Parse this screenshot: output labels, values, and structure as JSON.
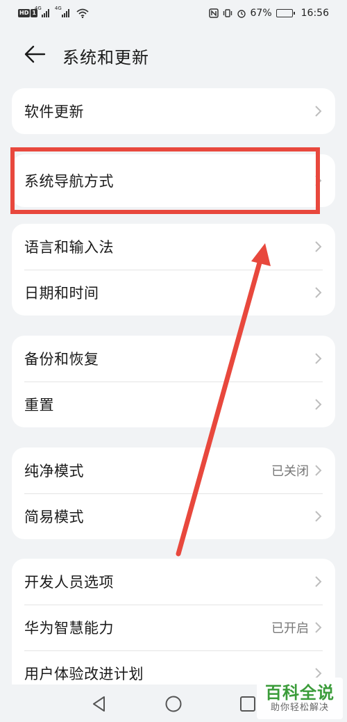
{
  "status_bar": {
    "hd": "HD",
    "sim1": "1",
    "net1": "4G",
    "net2": "4G",
    "battery": "67%",
    "time": "16:56"
  },
  "header": {
    "title": "系统和更新"
  },
  "groups": [
    {
      "items": [
        {
          "label": "软件更新",
          "value": ""
        }
      ]
    },
    {
      "items": [
        {
          "label": "系统导航方式",
          "value": ""
        }
      ]
    },
    {
      "items": [
        {
          "label": "语言和输入法",
          "value": ""
        },
        {
          "label": "日期和时间",
          "value": ""
        }
      ]
    },
    {
      "items": [
        {
          "label": "备份和恢复",
          "value": ""
        },
        {
          "label": "重置",
          "value": ""
        }
      ]
    },
    {
      "items": [
        {
          "label": "纯净模式",
          "value": "已关闭"
        },
        {
          "label": "简易模式",
          "value": ""
        }
      ]
    },
    {
      "items": [
        {
          "label": "开发人员选项",
          "value": ""
        },
        {
          "label": "华为智慧能力",
          "value": "已开启"
        },
        {
          "label": "用户体验改进计划",
          "value": ""
        }
      ]
    }
  ],
  "annotation": {
    "color": "#e8483d"
  },
  "watermark": {
    "title": "百科全说",
    "subtitle": "助你轻松解决"
  }
}
